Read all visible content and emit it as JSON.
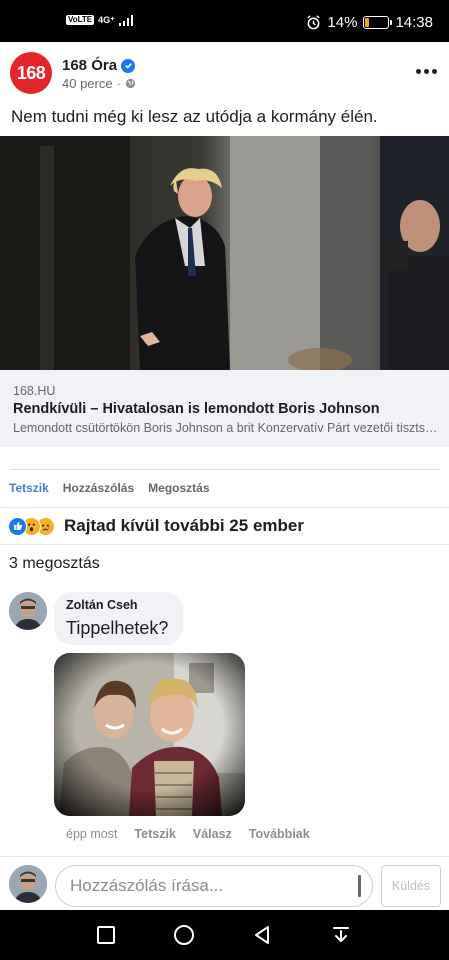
{
  "status_bar": {
    "network_badge": "VoLTE",
    "network_type": "4G⁺",
    "alarm_icon": "alarm-icon",
    "battery_percent": "14%",
    "battery_level": 0.14,
    "time": "14:38"
  },
  "post": {
    "page_avatar_text": "168",
    "page_name": "168 Óra",
    "time_ago": "40 perce",
    "meta_separator": "·",
    "privacy_icon": "globe-icon",
    "text": "Nem tudni még ki lesz az utódja a kormány élén.",
    "link": {
      "domain": "168.HU",
      "title": "Rendkívüli – Hivatalosan is lemondott Boris Johnson",
      "description": "Lemondott csütörtökön Boris Johnson a brit Konzervatív Párt vezetői tisztségéről"
    }
  },
  "actions": {
    "like": "Tetszik",
    "comment": "Hozzászólás",
    "share": "Megosztás"
  },
  "reactions": {
    "icons": [
      "like-icon",
      "wow-icon",
      "sad-icon"
    ],
    "summary": "Rajtad kívül további 25 ember"
  },
  "shares": "3 megosztás",
  "comment": {
    "author": "Zoltán Cseh",
    "text": "Tippelhetek?",
    "time": "épp most",
    "like": "Tetszik",
    "reply": "Válasz",
    "more": "Továbbiak"
  },
  "composer": {
    "placeholder": "Hozzászólás írása...",
    "send": "Küldés"
  },
  "colors": {
    "brand_red": "#e4262b",
    "facebook_blue": "#1877f2",
    "active_action": "#4a7dcb"
  }
}
